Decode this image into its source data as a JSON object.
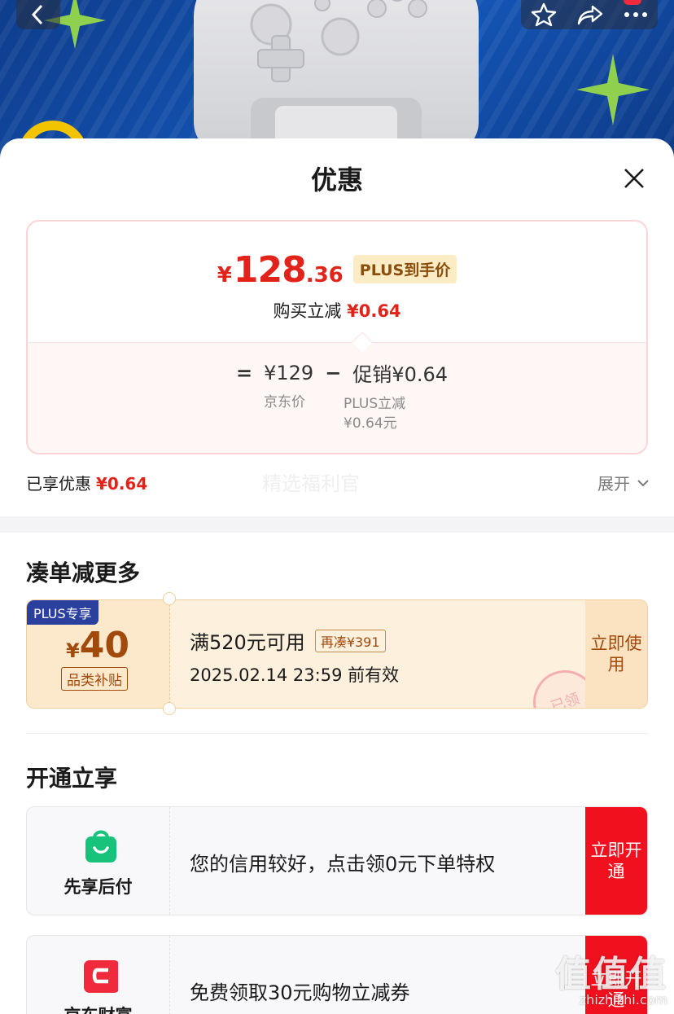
{
  "sheet": {
    "title": "优惠"
  },
  "price": {
    "currency": "¥",
    "integer": "128",
    "decimal": ".36",
    "tag": "PLUS到手价",
    "instant_label": "购买立减",
    "instant_value": "¥0.64"
  },
  "formula": {
    "equals": "=",
    "jd_price": "¥129",
    "minus": "−",
    "promo": "促销¥0.64",
    "jd_price_label": "京东价",
    "promo_label": "PLUS立减",
    "promo_sub": "¥0.64元"
  },
  "enjoyed": {
    "label": "已享优惠",
    "value": "¥0.64",
    "faded_text": "精选福利官",
    "expand_label": "展开"
  },
  "more_section": {
    "title": "凑单减更多",
    "coupon": {
      "badge": "PLUS专享",
      "currency": "¥",
      "amount": "40",
      "type": "品类补贴",
      "condition": "满520元可用",
      "extra": "再凑¥391",
      "expiry": "2025.02.14 23:59 前有效",
      "use_label": "立即使用",
      "stamp": "已领"
    }
  },
  "open_section": {
    "title": "开通立享",
    "services": [
      {
        "name": "先享后付",
        "desc": "您的信用较好，点击领0元下单特权",
        "button": "立即开通",
        "icon": "shopping-bag-icon",
        "color": "#17c27a"
      },
      {
        "name": "京东财富",
        "desc": "免费领取30元购物立减券",
        "button": "立即开通",
        "icon": "jd-wealth-icon",
        "color": "#f0293c"
      }
    ]
  },
  "watermark": {
    "big": "值值值",
    "small": "zhizhizhi.com"
  },
  "colors": {
    "accent_red": "#e2231a",
    "button_red": "#f0101e",
    "coupon_brown": "#a14a0c",
    "plus_blue": "#2a3f9e"
  }
}
